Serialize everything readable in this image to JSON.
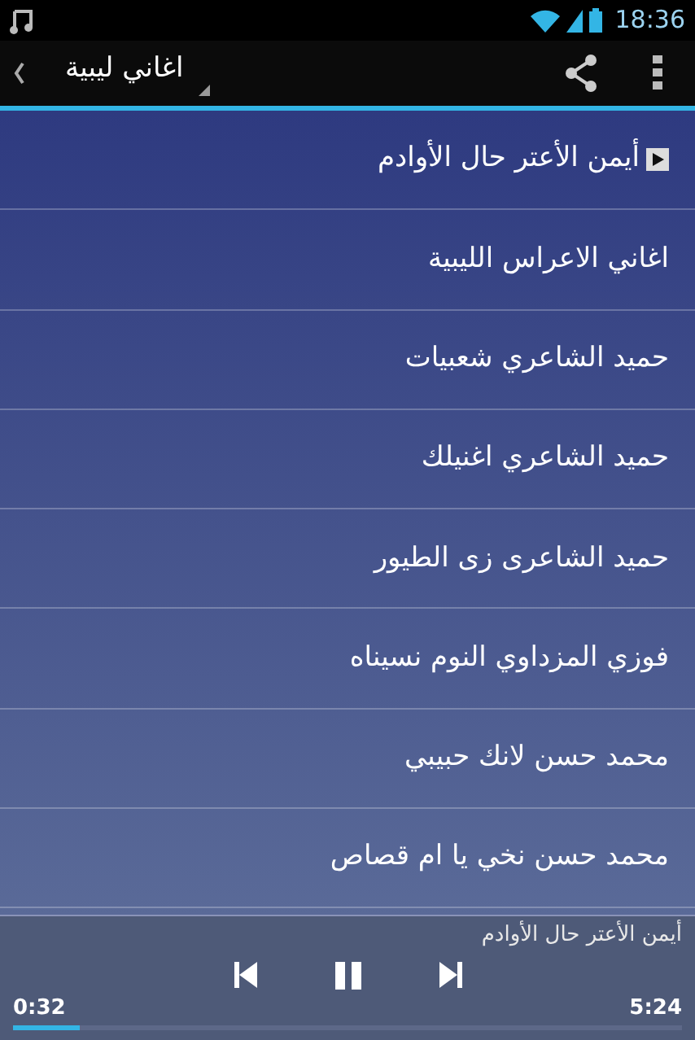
{
  "status_bar": {
    "time": "18:36"
  },
  "action_bar": {
    "title": "اغاني ليبية"
  },
  "songs": [
    {
      "title": "أيمن الأعتر حال الأوادم",
      "playing": true
    },
    {
      "title": "اغاني الاعراس الليبية",
      "playing": false
    },
    {
      "title": "حميد الشاعري شعبيات",
      "playing": false
    },
    {
      "title": "حميد الشاعري اغنيلك",
      "playing": false
    },
    {
      "title": "حميد الشاعرى زى الطيور",
      "playing": false
    },
    {
      "title": "فوزي المزداوي النوم نسيناه",
      "playing": false
    },
    {
      "title": "محمد حسن لانك حبيبي",
      "playing": false
    },
    {
      "title": "محمد حسن نخي يا ام قصاص",
      "playing": false
    }
  ],
  "player": {
    "now_playing": "أيمن الأعتر حال الأوادم",
    "elapsed": "0:32",
    "duration": "5:24",
    "level": 0.1
  }
}
